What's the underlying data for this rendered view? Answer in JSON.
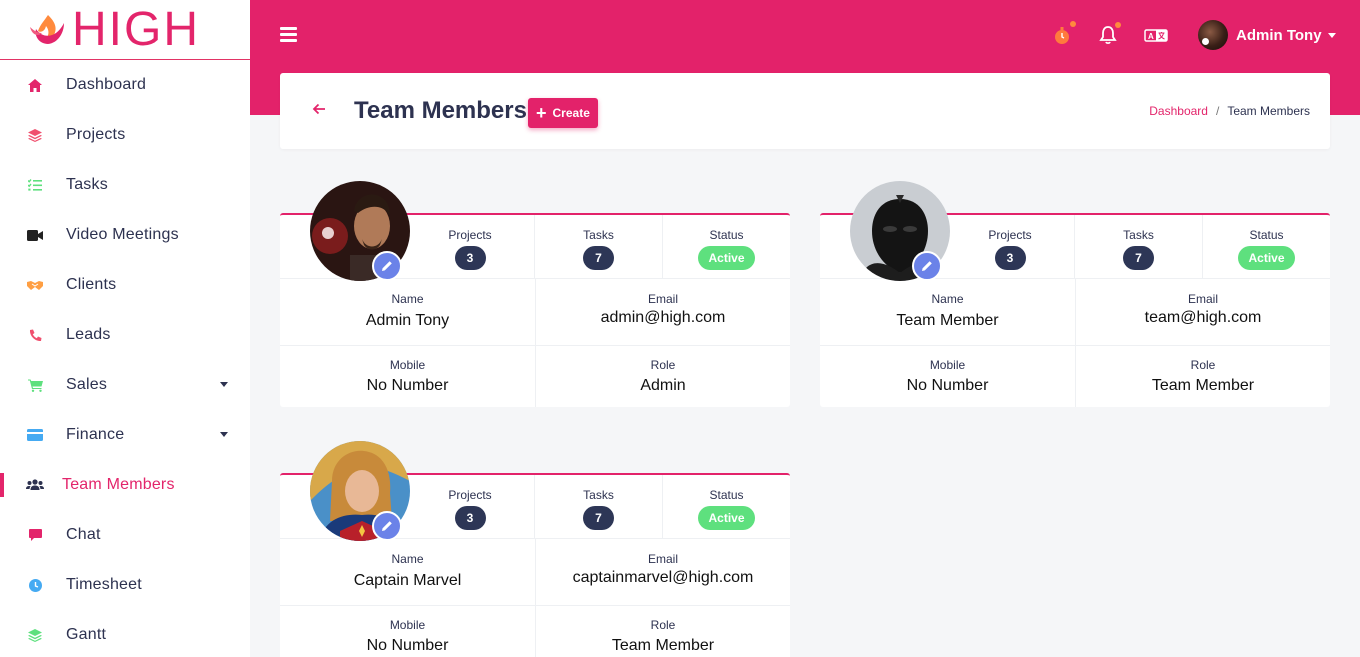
{
  "brand": {
    "name": "HIGH"
  },
  "colors": {
    "primary": "#e3226a",
    "status_active": "#5ee07e",
    "pill": "#2d3656",
    "edit": "#6b82e8"
  },
  "sidebar": {
    "items": [
      {
        "label": "Dashboard",
        "icon": "home-icon"
      },
      {
        "label": "Projects",
        "icon": "layers-icon"
      },
      {
        "label": "Tasks",
        "icon": "checklist-icon"
      },
      {
        "label": "Video Meetings",
        "icon": "video-icon"
      },
      {
        "label": "Clients",
        "icon": "handshake-icon"
      },
      {
        "label": "Leads",
        "icon": "phone-icon"
      },
      {
        "label": "Sales",
        "icon": "cart-icon"
      },
      {
        "label": "Finance",
        "icon": "credit-card-icon"
      },
      {
        "label": "Team Members",
        "icon": "users-icon"
      },
      {
        "label": "Chat",
        "icon": "chat-icon"
      },
      {
        "label": "Timesheet",
        "icon": "clock-icon"
      },
      {
        "label": "Gantt",
        "icon": "layers-icon"
      }
    ]
  },
  "header": {
    "user_name": "Admin Tony"
  },
  "page": {
    "title": "Team Members",
    "create_label": "Create",
    "breadcrumb": [
      "Dashboard",
      "/",
      "Team Members"
    ]
  },
  "labels": {
    "projects": "Projects",
    "tasks": "Tasks",
    "status": "Status",
    "name": "Name",
    "email": "Email",
    "mobile": "Mobile",
    "role": "Role"
  },
  "members": [
    {
      "projects": "3",
      "tasks": "7",
      "status": "Active",
      "name": "Admin Tony",
      "email": "admin@high.com",
      "mobile": "No Number",
      "role": "Admin"
    },
    {
      "projects": "3",
      "tasks": "7",
      "status": "Active",
      "name": "Team Member",
      "email": "team@high.com",
      "mobile": "No Number",
      "role": "Team Member"
    },
    {
      "projects": "3",
      "tasks": "7",
      "status": "Active",
      "name": "Captain Marvel",
      "email": "captainmarvel@high.com",
      "mobile": "No Number",
      "role": "Team Member"
    }
  ]
}
